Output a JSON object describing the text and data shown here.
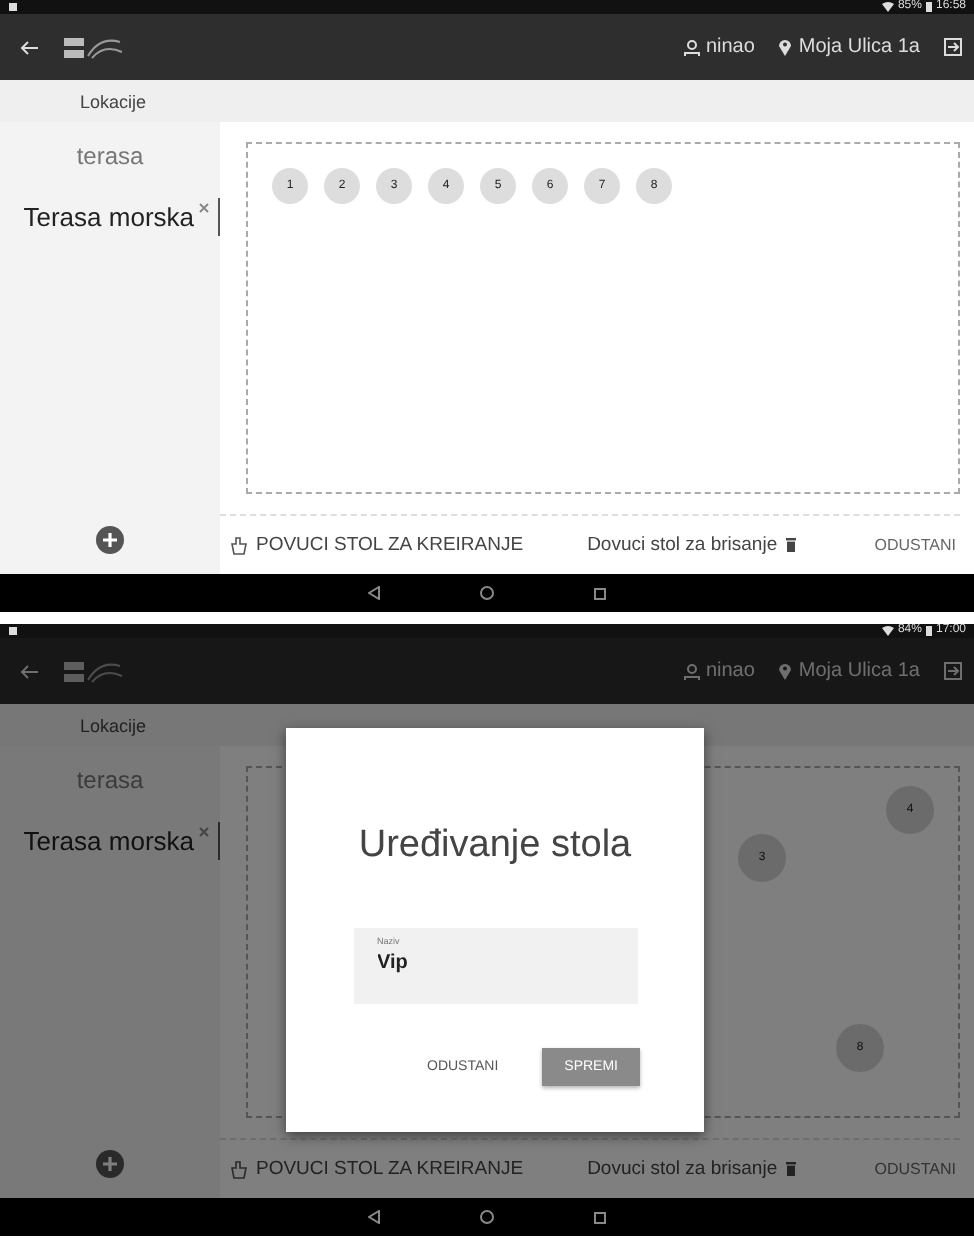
{
  "screens": [
    {
      "status_bar": {
        "battery": "85%",
        "time": "16:58"
      },
      "app_bar": {
        "user": "ninao",
        "address": "Moja Ulica 1a"
      },
      "section_title": "Lokacije",
      "locations": [
        {
          "name": "terasa",
          "selected": false
        },
        {
          "name": "Terasa morska",
          "selected": true
        }
      ],
      "canvas": {
        "kind": "row",
        "tables": [
          {
            "label": "1"
          },
          {
            "label": "2"
          },
          {
            "label": "3"
          },
          {
            "label": "4"
          },
          {
            "label": "5"
          },
          {
            "label": "6"
          },
          {
            "label": "7"
          },
          {
            "label": "8"
          }
        ]
      },
      "toolbar": {
        "create": "POVUCI STOL ZA KREIRANJE",
        "delete": "Dovuci stol za brisanje",
        "cancel": "ODUSTANI"
      }
    },
    {
      "status_bar": {
        "battery": "84%",
        "time": "17:00"
      },
      "app_bar": {
        "user": "ninao",
        "address": "Moja Ulica 1a"
      },
      "section_title": "Lokacije",
      "locations": [
        {
          "name": "terasa",
          "selected": false
        },
        {
          "name": "Terasa morska",
          "selected": true
        }
      ],
      "canvas": {
        "kind": "free",
        "tables": [
          {
            "label": "3"
          },
          {
            "label": "4"
          },
          {
            "label": "8"
          }
        ]
      },
      "toolbar": {
        "create": "POVUCI STOL ZA KREIRANJE",
        "delete": "Dovuci stol za brisanje",
        "cancel": "ODUSTANI"
      },
      "dialog": {
        "title": "Uređivanje stola",
        "field_label": "Naziv",
        "field_value": "Vip",
        "cancel": "ODUSTANI",
        "save": "SPREMI"
      }
    }
  ]
}
